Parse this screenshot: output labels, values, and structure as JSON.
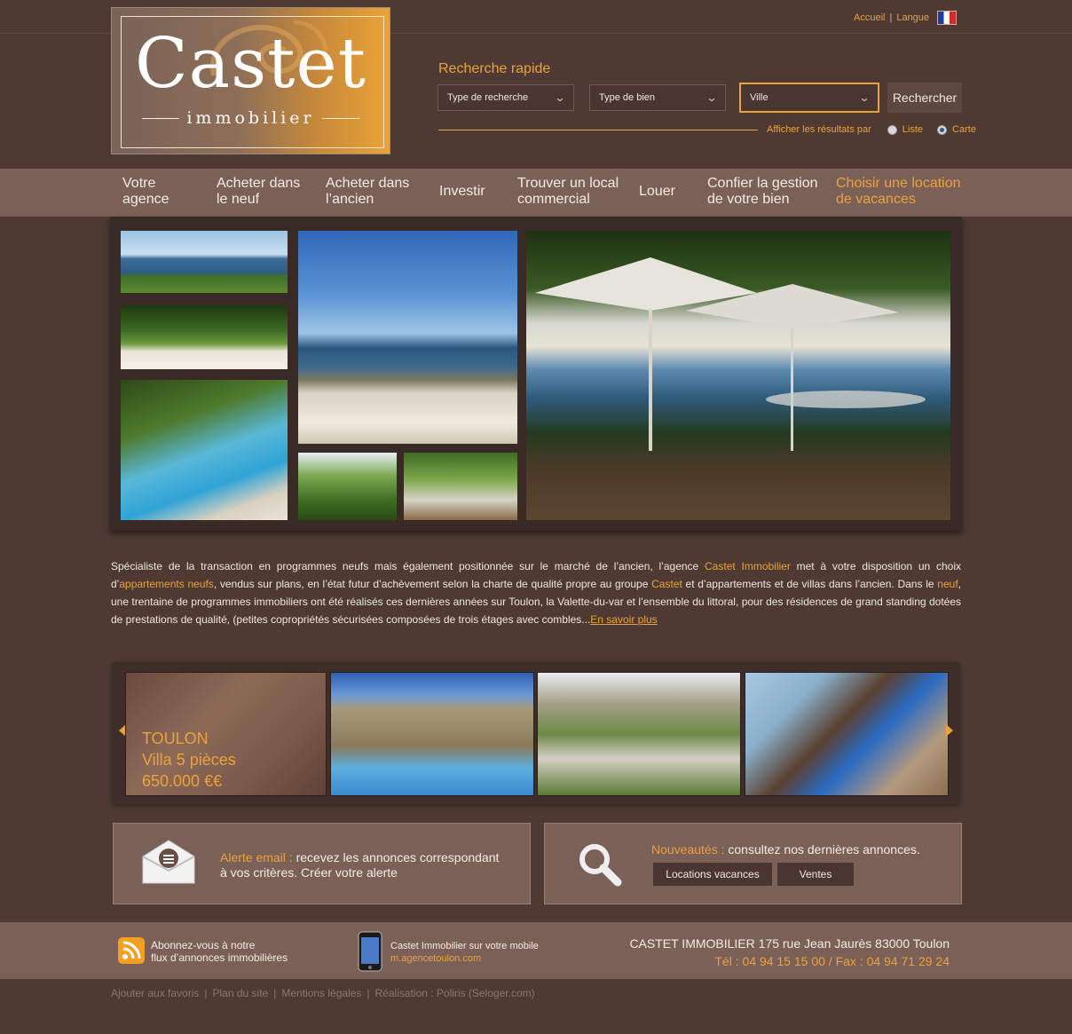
{
  "logo": {
    "title": "Castet",
    "subtitle": "immobilier"
  },
  "toplinks": {
    "home": "Accueil",
    "sep": "|",
    "language": "Langue"
  },
  "quick_search": {
    "title": "Recherche rapide",
    "search_type": "Type de recherche",
    "property_type": "Type de bien",
    "city": "Ville",
    "button": "Rechercher",
    "show_results_by": "Afficher les résultats par",
    "option_list": "Liste",
    "option_map": "Carte",
    "selected_option": "Carte"
  },
  "nav": {
    "items": [
      {
        "line1": "Votre",
        "line2": "agence"
      },
      {
        "line1": "Acheter dans",
        "line2": "le neuf"
      },
      {
        "line1": "Acheter dans",
        "line2": "l’ancien"
      },
      {
        "line1": "Investir",
        "line2": ""
      },
      {
        "line1": "Trouver un local",
        "line2": "commercial"
      },
      {
        "line1": "Louer",
        "line2": ""
      },
      {
        "line1": "Confier la gestion",
        "line2": "de votre bien"
      },
      {
        "line1": "Choisir une location",
        "line2": "de vacances"
      }
    ]
  },
  "intro": {
    "p1": "Spécialiste de la transaction en programmes neufs mais également positionnée sur le marché de l’ancien, l’agence ",
    "link1": "Castet Immobilier",
    "p2": " met à votre disposition un choix d’",
    "link2": "appartements neufs",
    "p3": ", vendus sur plans, en l’état futur d’achèvement selon la charte de qualité propre au groupe ",
    "link3": "Castet",
    "p4": " et d’appartements et de villas dans l’ancien. Dans le ",
    "link4": "neuf",
    "p5": ", une trentaine de programmes immobiliers ont été réalisés ces dernières années sur Toulon, la Valette-du-var et l’ensemble du littoral, pour des résidences de grand standing dotées de prestations de qualité, (petites copropriétés sécurisées composées de trois étages avec combles...",
    "more": "En savoir plus"
  },
  "carousel": {
    "featured": {
      "city": "TOULON",
      "type": "Villa 5 pièces",
      "price": "650.000 €€"
    }
  },
  "alert_box": {
    "highlight": "Alerte email :",
    "text1": " recevez les annonces correspondant",
    "text2": "à vos critères. Créer votre alerte"
  },
  "news_box": {
    "highlight": "Nouveautés :",
    "text": " consultez nos dernières annonces.",
    "btn_holiday": "Locations vacances",
    "btn_sales": "Ventes"
  },
  "footer": {
    "rss1": "Abonnez-vous à notre",
    "rss2": "flux d’annonces immobilières",
    "mobile1": "Castet Immobilier sur votre mobile",
    "mobile2": "m.agencetoulon.com",
    "address": "CASTET IMMOBILIER 175 rue Jean Jaurès 83000 Toulon",
    "phone": "Tél : 04 94 15 15 00 / Fax : 04 94 71 29 24"
  },
  "bottom_links": [
    "Ajouter aux favoris",
    "|",
    "Plan du site",
    "|",
    "Mentions légales",
    "|",
    "Réalisation : Poliris (Seloger.com)"
  ],
  "colors": {
    "background": "#4e3a33",
    "panel": "#7b6058",
    "accent": "#eaa23a"
  }
}
